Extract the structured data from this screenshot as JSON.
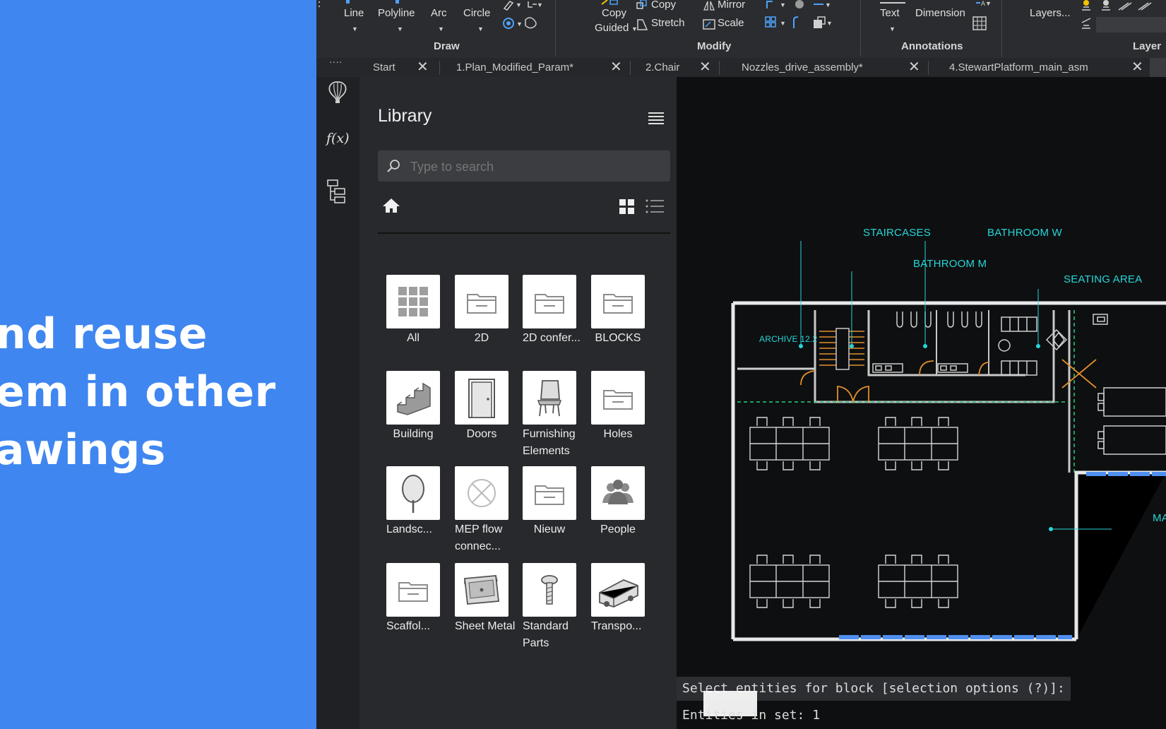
{
  "promo": {
    "lines": [
      "nd reuse",
      "em in other",
      "awings"
    ]
  },
  "ribbon": {
    "draw_tools": [
      "Line",
      "Polyline",
      "Arc",
      "Circle"
    ],
    "modify_tools": {
      "copy_guided_1": "Copy",
      "copy_guided_2": "Guided",
      "copy": "Copy",
      "mirror": "Mirror",
      "stretch": "Stretch",
      "scale": "Scale"
    },
    "annotation_tools": {
      "text": "Text",
      "dimension": "Dimension"
    },
    "layers_button": "Layers...",
    "groups": {
      "draw": "Draw",
      "modify": "Modify",
      "annotations": "Annotations",
      "layers": "Layer"
    }
  },
  "tabs": [
    {
      "label": "Start"
    },
    {
      "label": "1.Plan_Modified_Param*"
    },
    {
      "label": "2.Chair"
    },
    {
      "label": "Nozzles_drive_assembly*"
    },
    {
      "label": "4.StewartPlatform_main_asm"
    }
  ],
  "sidebar": {
    "formula_icon_label": "f(x)"
  },
  "library": {
    "title": "Library",
    "search_placeholder": "Type to search",
    "items": [
      {
        "name": "All",
        "icon": "grid-icon"
      },
      {
        "name": "2D",
        "icon": "folder-icon"
      },
      {
        "name": "2D confer...",
        "icon": "folder-icon"
      },
      {
        "name": "BLOCKS",
        "icon": "folder-icon"
      },
      {
        "name": "Building",
        "icon": "stairs-icon"
      },
      {
        "name": "Doors",
        "icon": "door-icon"
      },
      {
        "name": "Furnishing Elements",
        "icon": "chair-icon"
      },
      {
        "name": "Holes",
        "icon": "folder-icon"
      },
      {
        "name": "Landsc...",
        "icon": "tree-icon"
      },
      {
        "name": "MEP flow connec...",
        "icon": "valve-icon"
      },
      {
        "name": "Nieuw",
        "icon": "folder-icon"
      },
      {
        "name": "People",
        "icon": "people-icon"
      },
      {
        "name": "Scaffol...",
        "icon": "folder-icon"
      },
      {
        "name": "Sheet Metal",
        "icon": "sheet-metal-icon"
      },
      {
        "name": "Standard Parts",
        "icon": "bolt-icon"
      },
      {
        "name": "Transpo...",
        "icon": "truck-icon"
      }
    ]
  },
  "drawing": {
    "labels": {
      "staircases": "STAIRCASES",
      "bathroom_w": "BATHROOM W",
      "bathroom_m": "BATHROOM M",
      "seating_area": "SEATING AREA",
      "archive": "ARCHIVE 12.2",
      "ma": "MA"
    }
  },
  "command_line": {
    "prompt": "Select entities for block [selection options (?)]:",
    "status": "Entities in set: 1"
  },
  "colors": {
    "promo_bg": "#3f86f0",
    "cad_label": "#27d6d8",
    "door": "#e0902a"
  }
}
